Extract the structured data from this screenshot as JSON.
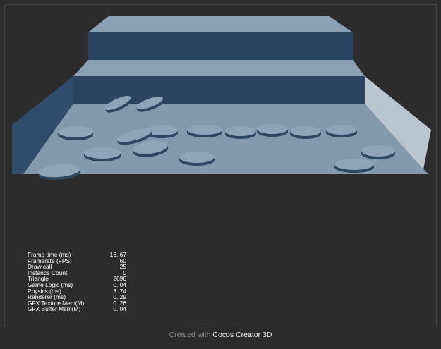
{
  "stats": [
    {
      "label": "Frame time (ms)",
      "value": "16. 67"
    },
    {
      "label": "Framerate (FPS)",
      "value": "60"
    },
    {
      "label": "Draw call",
      "value": "25"
    },
    {
      "label": "Instance Count",
      "value": "0"
    },
    {
      "label": "Triangle",
      "value": "2696"
    },
    {
      "label": "Game Logic (ms)",
      "value": "0. 04"
    },
    {
      "label": "Physics (ms)",
      "value": "3. 74"
    },
    {
      "label": "Renderer (ms)",
      "value": "0. 29"
    },
    {
      "label": "GFX Texture Mem(M)",
      "value": "0. 26"
    },
    {
      "label": "GFX Buffer Mem(M)",
      "value": "0. 04"
    }
  ],
  "footer": {
    "prefix": "Created with",
    "link_text": "Cocos Creator 3D"
  },
  "colors": {
    "background": "#2b2b2b",
    "step_top": "#8aa1b6",
    "step_front": "#2b4560",
    "floor": "#8299ae",
    "left_wall": "#2f4d6b",
    "right_wall": "#bac5cf",
    "disc_top": "#8ea5b9",
    "disc_side": "#2c4761"
  }
}
